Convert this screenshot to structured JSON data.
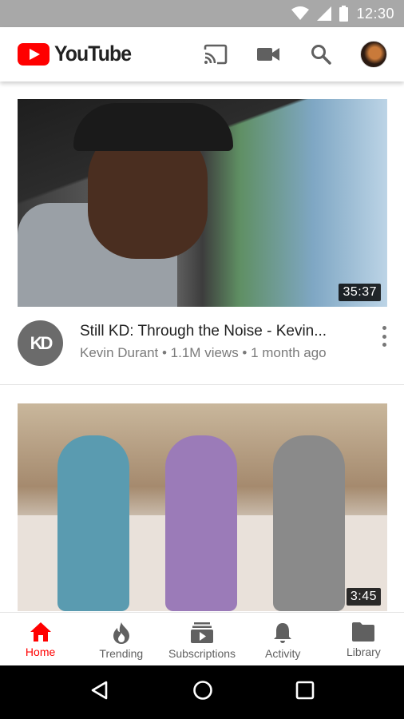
{
  "status_bar": {
    "time": "12:30"
  },
  "app": {
    "name": "YouTube",
    "brand_color": "#ff0000",
    "actions": [
      {
        "icon": "cast-icon"
      },
      {
        "icon": "video-camera-icon"
      },
      {
        "icon": "search-icon"
      },
      {
        "icon": "account-avatar"
      }
    ]
  },
  "feed": {
    "videos": [
      {
        "duration": "35:37",
        "title": "Still KD: Through the Noise - Kevin...",
        "channel_avatar_text": "KD",
        "meta": "Kevin Durant • 1.1M views • 1 month ago"
      },
      {
        "duration": "3:45"
      }
    ]
  },
  "bottom_nav": {
    "items": [
      {
        "label": "Home",
        "icon": "home-icon",
        "active": true
      },
      {
        "label": "Trending",
        "icon": "flame-icon",
        "active": false
      },
      {
        "label": "Subscriptions",
        "icon": "subscriptions-icon",
        "active": false
      },
      {
        "label": "Activity",
        "icon": "bell-icon",
        "active": false
      },
      {
        "label": "Library",
        "icon": "folder-icon",
        "active": false
      }
    ],
    "active_color": "#ff0000"
  },
  "system_nav": [
    "back-icon",
    "home-circle-icon",
    "recents-icon"
  ]
}
